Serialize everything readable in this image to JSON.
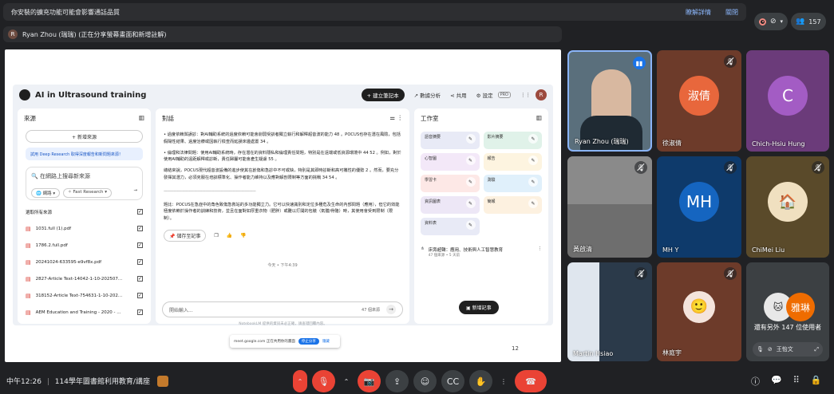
{
  "banner": {
    "message": "你安裝的擴充功能可能會影響通話品質",
    "learn_more": "瞭解詳情",
    "close": "關閉"
  },
  "top_right": {
    "participant_count": "157"
  },
  "presenter": {
    "initial": "R",
    "text": "Ryan Zhou (瑞瑞) (正在分享螢幕畫面和新增註解)"
  },
  "notebook": {
    "title": "AI in Ultrasound training",
    "create_note": "+ 建立筆記本",
    "analytics": "數據分析",
    "share": "共用",
    "settings": "設定",
    "pro": "PRO",
    "avatar": "R",
    "sources": {
      "header": "來源",
      "add": "+ 新增來源",
      "deep_research": "試用 Deep Research 取得深度報告和新問題來源！",
      "search_placeholder": "在網路上搜尋新來源",
      "chip_web": "網路",
      "chip_fast": "Fast Research",
      "select_all": "選取所有來源",
      "files": [
        "1031.full (1).pdf",
        "1786.2.full.pdf",
        "20241024-633595-e9vf8x.pdf",
        "2827-Article Text-14042-1-10-202507...",
        "318152-Article Text-754631-1-10-202...",
        "AEM Education and Training - 2020 - ..."
      ]
    },
    "chat": {
      "header": "對話",
      "p1": "• 過度依賴與誤診：對AI輔助系統的過度依賴可能會削弱受訓者獨立執行和解釋超音波的能力 48 。POCUS也存在潛在風險，包括假陽性結果、過度治療或因執行檢查而延誤床邊處置 34 。",
      "p2": "• 倫理和法律問題：使用AI輔助系統時，存在潛在的資料隱私和倫理責任問題，特別是在遠端或低資源環境中 44 52 。例如，對於使用AI輔助的遠距解釋或診斷，責任歸屬可能會產生疑慮 55 。",
      "p3": "總結來說，POCUS現代超音波設備的進步使其在創傷和急診中不可或缺，特別是其即時診斷和高可攜性的優勢 2 。然而，要充分發揮其潛力，必須克服在培訓標準化、操作者能力維持以及應對解剖限制等方面的挑戰 34 54 。",
      "sep": "------------------------------------------------------------------------------------",
      "p4": "題比：POCUS在急症中的角色致傷急救站的多功能獨立力。它可以快速識別和定位多種危及生命的內部問題（應用），但它的效能極度依賴於操作者的訓練和技術，並且在面對如厚重衣物（肥胖）或難以打開的包裝（氣體/骨骼）時，其使用會受到限制（限制）。",
      "save_note": "儲存至記事",
      "timestamp": "今天 • 下午4:39",
      "input_placeholder": "開始輸入...",
      "source_count": "47 個來源"
    },
    "studio": {
      "header": "工作室",
      "tiles": [
        {
          "label": "語音摘要",
          "color": "#e8eaf6"
        },
        {
          "label": "影片摘要",
          "color": "#e0f2e9"
        },
        {
          "label": "心智圖",
          "color": "#f3e8f8"
        },
        {
          "label": "報告",
          "color": "#fdf4e0"
        },
        {
          "label": "學習卡",
          "color": "#fde8e6"
        },
        {
          "label": "測驗",
          "color": "#e0f0fb"
        },
        {
          "label": "資訊圖表",
          "color": "#ede7f6"
        },
        {
          "label": "簡報",
          "color": "#fdf1e0"
        },
        {
          "label": "資料表",
          "color": "#e8eaf6"
        }
      ],
      "note_title": "床旁超聲：應用、技術與人工智慧教育",
      "note_sub": "47 個來源 • 5 天前",
      "add_note": "新增記事"
    },
    "footer": "NotebookLM 提供的資訊未必正確，請查證回覆內容。"
  },
  "share_bar": {
    "text": "meet.google.com 正在共用你的畫面",
    "stop": "停止分享",
    "hide": "隱藏"
  },
  "page_number": "12",
  "participants": [
    {
      "name": "Ryan Zhou (瑞瑞)"
    },
    {
      "name": "徐淑倩",
      "initial": "淑倩"
    },
    {
      "name": "Chich-Hsiu Hung",
      "initial": "C"
    },
    {
      "name": "黃啟清"
    },
    {
      "name": "MH Y",
      "initial": "MH"
    },
    {
      "name": "ChiMei Liu"
    },
    {
      "name": "Martin Hsiao"
    },
    {
      "name": "林庭宇"
    }
  ],
  "more": {
    "text": "還有另外 147 位使用者",
    "sub_name": "王怡文",
    "circle_label": "雅琳"
  },
  "bottom": {
    "time": "中午12:26",
    "meeting": "114學年圖書館利用教育/講座"
  }
}
